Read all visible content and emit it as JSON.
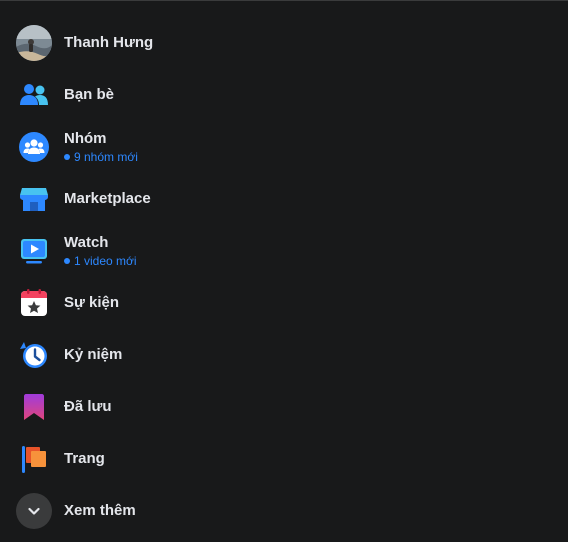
{
  "menu": {
    "profile": {
      "name": "Thanh Hưng",
      "icon": "profile-avatar"
    },
    "friends": {
      "label": "Bạn bè",
      "icon": "friends-icon"
    },
    "groups": {
      "label": "Nhóm",
      "sub": "9 nhóm mới",
      "icon": "groups-icon"
    },
    "marketplace": {
      "label": "Marketplace",
      "icon": "marketplace-icon"
    },
    "watch": {
      "label": "Watch",
      "sub": "1 video mới",
      "icon": "watch-icon"
    },
    "events": {
      "label": "Sự kiện",
      "icon": "events-icon"
    },
    "memories": {
      "label": "Kỷ niệm",
      "icon": "memories-icon"
    },
    "saved": {
      "label": "Đã lưu",
      "icon": "saved-icon"
    },
    "pages": {
      "label": "Trang",
      "icon": "pages-icon"
    },
    "see_more": {
      "label": "Xem thêm",
      "icon": "chevron-down-icon"
    }
  },
  "colors": {
    "background": "#18191a",
    "text": "#e4e6eb",
    "accent": "#2d88ff"
  }
}
